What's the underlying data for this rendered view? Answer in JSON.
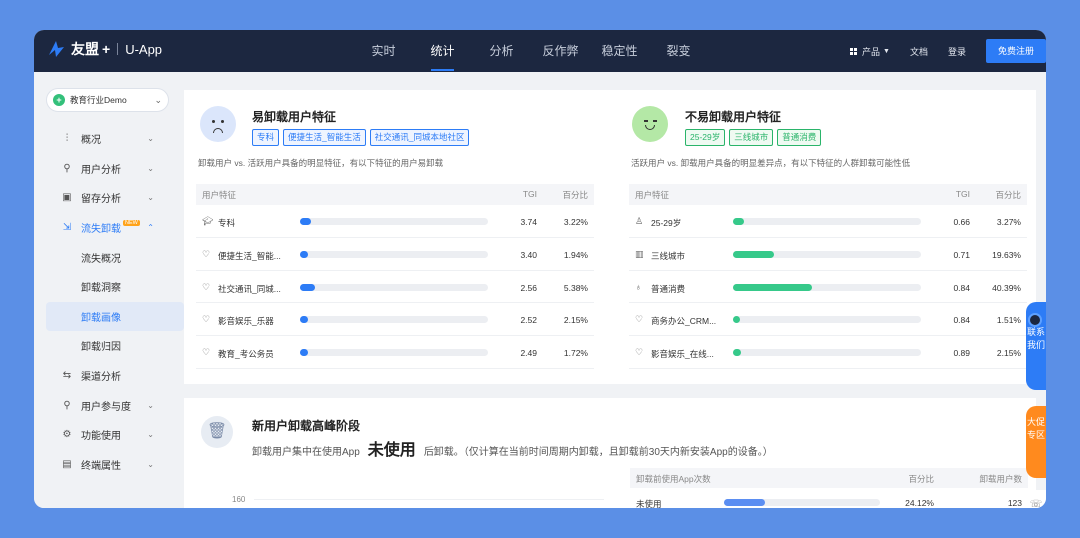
{
  "header": {
    "brand": "友盟",
    "plus": "+",
    "product": "U-App",
    "nav": [
      {
        "label": "实时",
        "active": false
      },
      {
        "label": "统计",
        "active": true
      },
      {
        "label": "分析",
        "active": false
      },
      {
        "label": "反作弊",
        "active": false
      },
      {
        "label": "稳定性",
        "active": false
      },
      {
        "label": "裂变",
        "active": false
      }
    ],
    "product_menu": "产品",
    "docs": "文档",
    "login": "登录",
    "signup": "免费注册"
  },
  "sidebar": {
    "project": "教育行业Demo",
    "items": [
      {
        "icon": "chart-icon",
        "glyph": "⫶",
        "label": "概况"
      },
      {
        "icon": "user-icon",
        "glyph": "⚲",
        "label": "用户分析"
      },
      {
        "icon": "retention-icon",
        "glyph": "▣",
        "label": "留存分析"
      },
      {
        "icon": "churn-icon",
        "glyph": "⇲",
        "label": "流失卸载",
        "badge": "NEW"
      },
      {
        "label": "流失概况"
      },
      {
        "label": "卸载洞察"
      },
      {
        "label": "卸载画像"
      },
      {
        "label": "卸载归因"
      },
      {
        "icon": "channel-icon",
        "glyph": "⇆",
        "label": "渠道分析"
      },
      {
        "icon": "engagement-icon",
        "glyph": "⚲",
        "label": "用户参与度"
      },
      {
        "icon": "function-icon",
        "glyph": "⚙",
        "label": "功能使用"
      },
      {
        "icon": "device-icon",
        "glyph": "▤",
        "label": "终端属性"
      }
    ]
  },
  "easy_uninstall": {
    "title": "易卸载用户特征",
    "tags": [
      "专科",
      "便捷生活_智能生活",
      "社交通讯_同城本地社区"
    ],
    "desc": "卸载用户 vs. 活跃用户具备的明显特征，有以下特征的用户易卸载",
    "columns": [
      "用户特征",
      "TGI",
      "百分比"
    ],
    "rows": [
      {
        "icon": "education-icon",
        "glyph": "🎓︎",
        "label": "专科",
        "tgi": "3.74",
        "pct": "3.22%",
        "fill": 0.06
      },
      {
        "icon": "heart-icon",
        "glyph": "♡",
        "label": "便捷生活_智能...",
        "tgi": "3.40",
        "pct": "1.94%",
        "fill": 0.04
      },
      {
        "icon": "heart-icon",
        "glyph": "♡",
        "label": "社交通讯_同城...",
        "tgi": "2.56",
        "pct": "5.38%",
        "fill": 0.08
      },
      {
        "icon": "heart-icon",
        "glyph": "♡",
        "label": "影音娱乐_乐器",
        "tgi": "2.52",
        "pct": "2.15%",
        "fill": 0.045
      },
      {
        "icon": "heart-icon",
        "glyph": "♡",
        "label": "教育_考公务员",
        "tgi": "2.49",
        "pct": "1.72%",
        "fill": 0.04
      }
    ],
    "bar_color": "#2d7cf6"
  },
  "hard_uninstall": {
    "title": "不易卸载用户特征",
    "tags": [
      "25-29岁",
      "三线城市",
      "普通消费"
    ],
    "desc": "活跃用户 vs. 卸载用户具备的明显差异点，有以下特征的人群卸载可能性低",
    "columns": [
      "用户特征",
      "TGI",
      "百分比"
    ],
    "rows": [
      {
        "icon": "age-icon",
        "glyph": "♙",
        "label": "25-29岁",
        "tgi": "0.66",
        "pct": "3.27%",
        "fill": 0.06
      },
      {
        "icon": "city-icon",
        "glyph": "▥",
        "label": "三线城市",
        "tgi": "0.71",
        "pct": "19.63%",
        "fill": 0.22
      },
      {
        "icon": "wallet-icon",
        "glyph": "♁",
        "label": "普通消费",
        "tgi": "0.84",
        "pct": "40.39%",
        "fill": 0.42
      },
      {
        "icon": "heart-icon",
        "glyph": "♡",
        "label": "商务办公_CRM...",
        "tgi": "0.84",
        "pct": "1.51%",
        "fill": 0.035
      },
      {
        "icon": "heart-icon",
        "glyph": "♡",
        "label": "影音娱乐_在线...",
        "tgi": "0.89",
        "pct": "2.15%",
        "fill": 0.045
      }
    ],
    "bar_color": "#36c98a"
  },
  "peak": {
    "title": "新用户卸载高峰阶段",
    "desc_prefix": "卸载用户集中在使用App",
    "highlight": "未使用",
    "desc_suffix": "后卸载。（仅计算在当前时间周期内卸载，且卸载前30天内新安装App的设备。）",
    "y_tick": "160",
    "columns": [
      "卸载前使用App次数",
      "百分比",
      "卸载用户数"
    ],
    "rows": [
      {
        "label": "未使用",
        "pct": "24.12%",
        "count": "123",
        "fill": 0.26
      }
    ]
  },
  "floating": {
    "contact": "联系我们",
    "promo": "大促专区"
  }
}
